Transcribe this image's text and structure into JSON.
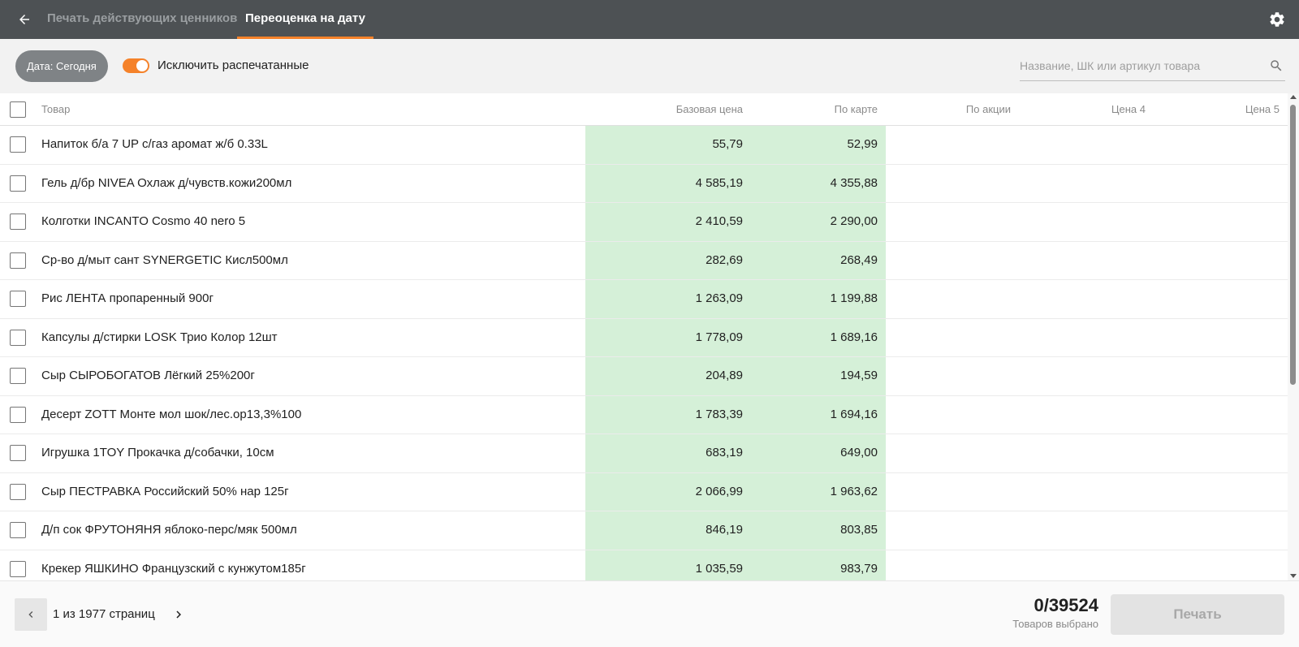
{
  "header": {
    "tabs": [
      {
        "label": "Печать действующих ценников",
        "active": false
      },
      {
        "label": "Переоценка на дату",
        "active": true
      }
    ],
    "icons": {
      "back": "arrow-left-icon",
      "settings": "gear-icon"
    }
  },
  "filters": {
    "date_chip": "Дата: Сегодня",
    "exclude_printed": {
      "label": "Исключить распечатанные",
      "checked": true
    },
    "search": {
      "placeholder": "Название, ШК или артикул товара",
      "value": ""
    }
  },
  "table": {
    "columns": [
      "Товар",
      "Базовая цена",
      "По карте",
      "По акции",
      "Цена 4",
      "Цена 5"
    ],
    "rows": [
      {
        "name": "Напиток б/а 7 UP с/газ аромат ж/б 0.33L",
        "base": "55,79",
        "card": "52,99"
      },
      {
        "name": "Гель д/бр NIVEA Охлаж д/чувств.кожи200мл",
        "base": "4 585,19",
        "card": "4 355,88"
      },
      {
        "name": "Колготки INCANTO Cosmo 40 nero 5",
        "base": "2 410,59",
        "card": "2 290,00"
      },
      {
        "name": "Ср-во д/мыт сант SYNERGETIC Кисл500мл",
        "base": "282,69",
        "card": "268,49"
      },
      {
        "name": "Рис ЛЕНТА пропаренный 900г",
        "base": "1 263,09",
        "card": "1 199,88"
      },
      {
        "name": "Капсулы д/стирки LOSK Трио Колор 12шт",
        "base": "1 778,09",
        "card": "1 689,16"
      },
      {
        "name": "Сыр СЫРОБОГАТОВ Лёгкий 25%200г",
        "base": "204,89",
        "card": "194,59"
      },
      {
        "name": "Десерт ZOTT Монте мол шок/лес.ор13,3%100",
        "base": "1 783,39",
        "card": "1 694,16"
      },
      {
        "name": "Игрушка 1TOY Прокачка д/собачки, 10см",
        "base": "683,19",
        "card": "649,00"
      },
      {
        "name": "Сыр ПЕСТРАВКА Российский 50% нар 125г",
        "base": "2 066,99",
        "card": "1 963,62"
      },
      {
        "name": "Д/п сок ФРУТОНЯНЯ яблоко-перс/мяк 500мл",
        "base": "846,19",
        "card": "803,85"
      },
      {
        "name": "Крекер ЯШКИНО Французский с кунжутом185г",
        "base": "1 035,59",
        "card": "983,79"
      }
    ],
    "highlight_color": "#d5f0d8"
  },
  "footer": {
    "pagination": "1 из 1977 страниц",
    "selected": "0/39524",
    "selected_caption": "Товаров выбрано",
    "print_label": "Печать"
  },
  "colors": {
    "accent": "#f5822a",
    "topbar": "#4d5154"
  }
}
